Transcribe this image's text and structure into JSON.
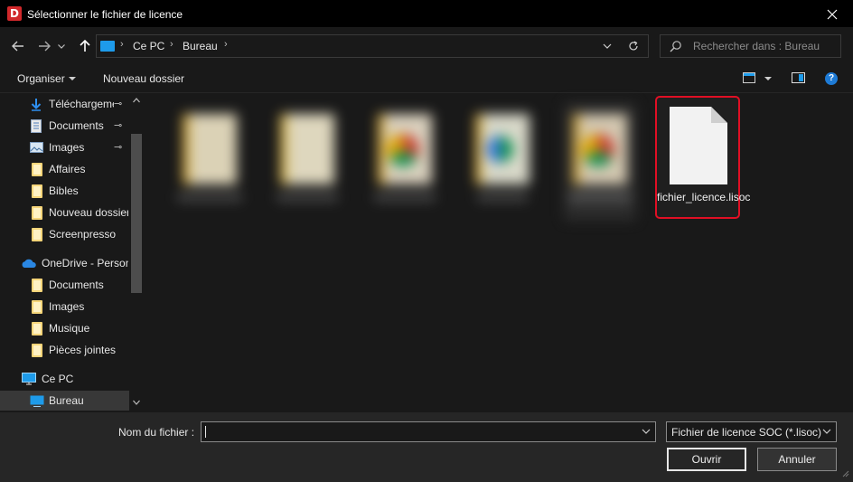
{
  "window": {
    "title": "Sélectionner le fichier de licence",
    "app_icon_letter": "D",
    "close_glyph": "✕"
  },
  "nav": {
    "back_icon": "arrow-left-icon",
    "forward_icon": "arrow-right-icon",
    "history_icon": "chevron-down-icon",
    "up_icon": "arrow-up-icon",
    "address": {
      "crumbs": [
        "Ce PC",
        "Bureau"
      ],
      "separator": "›"
    },
    "search_placeholder": "Rechercher dans : Bureau"
  },
  "commands": {
    "organize": "Organiser",
    "new_folder": "Nouveau dossier"
  },
  "sidebar": {
    "items": [
      {
        "label": "Téléchargements",
        "icon": "download-icon",
        "pinned": true
      },
      {
        "label": "Documents",
        "icon": "document-icon",
        "pinned": true
      },
      {
        "label": "Images",
        "icon": "image-icon",
        "pinned": true
      },
      {
        "label": "Affaires",
        "icon": "folder-icon"
      },
      {
        "label": "Bibles",
        "icon": "folder-icon"
      },
      {
        "label": "Nouveau dossier",
        "icon": "folder-icon"
      },
      {
        "label": "Screenpresso",
        "icon": "folder-icon"
      },
      {
        "label": "OneDrive - Personnel",
        "icon": "cloud-icon"
      },
      {
        "label": "Documents",
        "icon": "folder-icon"
      },
      {
        "label": "Images",
        "icon": "folder-icon"
      },
      {
        "label": "Musique",
        "icon": "folder-icon"
      },
      {
        "label": "Pièces jointes",
        "icon": "folder-icon"
      },
      {
        "label": "Ce PC",
        "icon": "computer-icon"
      },
      {
        "label": "Bureau",
        "icon": "desktop-icon",
        "selected": true
      }
    ],
    "pin_glyph": "📌"
  },
  "files": {
    "highlighted": {
      "name": "fichier_licence.lisoc",
      "icon": "blank-file-icon"
    }
  },
  "footer": {
    "filename_label": "Nom du fichier :",
    "filename_value": "",
    "filter_value": "Fichier de licence SOC (*.lisoc)",
    "open_label": "Ouvrir",
    "cancel_label": "Annuler"
  },
  "colors": {
    "accent": "#1e9bea",
    "highlight_border": "#e00f24",
    "background": "#191919"
  }
}
